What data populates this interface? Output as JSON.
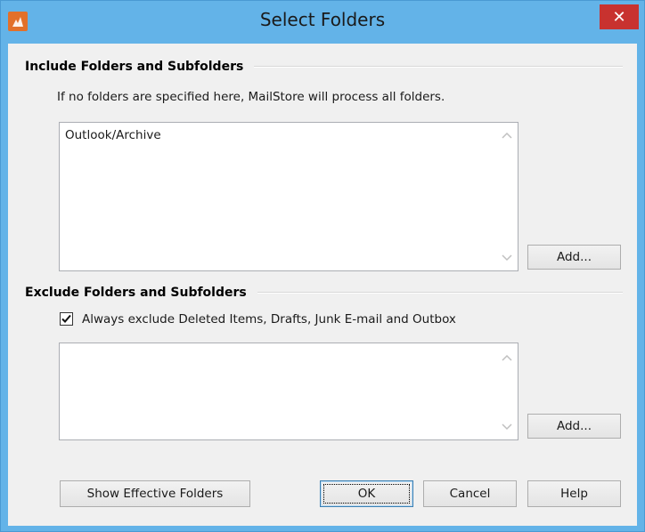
{
  "window": {
    "title": "Select Folders",
    "close_glyph": "✕",
    "app_icon": "mailstore-logo-icon",
    "frame_color": "#63b3e8",
    "close_color": "#c8322f"
  },
  "include": {
    "heading": "Include Folders and Subfolders",
    "info": "If no folders are specified here, MailStore will process all folders.",
    "items": [
      "Outlook/Archive"
    ],
    "add_label": "Add..."
  },
  "exclude": {
    "heading": "Exclude Folders and Subfolders",
    "checkbox_label": "Always exclude Deleted Items, Drafts, Junk E-mail and Outbox",
    "checkbox_checked": true,
    "items": [],
    "add_label": "Add..."
  },
  "footer": {
    "show_effective_label": "Show Effective Folders",
    "ok_label": "OK",
    "cancel_label": "Cancel",
    "help_label": "Help"
  }
}
